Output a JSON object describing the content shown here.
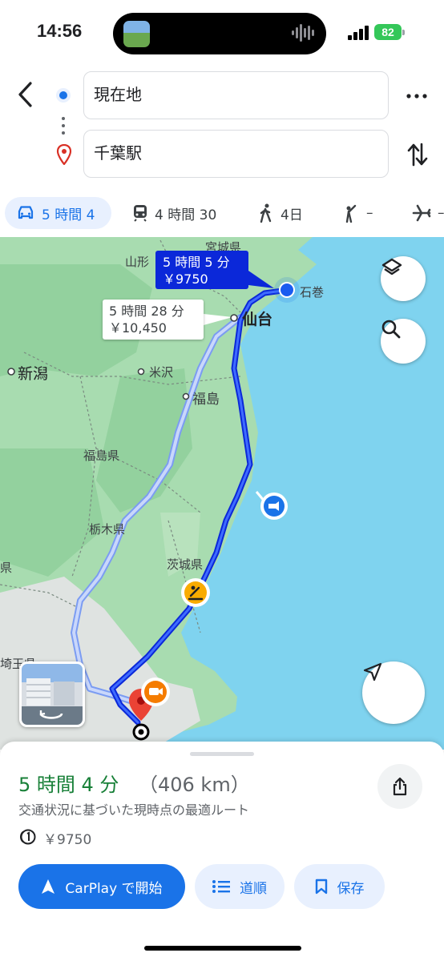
{
  "status_bar": {
    "time": "14:56",
    "battery": "82"
  },
  "route_inputs": {
    "origin": "現在地",
    "destination": "千葉駅"
  },
  "modes": [
    {
      "icon": "car-icon",
      "label": "5 時間 4"
    },
    {
      "icon": "train-icon",
      "label": "4 時間 30"
    },
    {
      "icon": "walk-icon",
      "label": "4日"
    },
    {
      "icon": "ride-icon",
      "label": "–"
    },
    {
      "icon": "flight-icon",
      "label": "–"
    }
  ],
  "map": {
    "route_fast": {
      "time": "5 時間 5 分",
      "cost": "￥9750"
    },
    "route_alt": {
      "time": "5 時間 28 分",
      "cost": "￥10,450"
    },
    "places": {
      "sendai": "仙台",
      "niigata": "新潟",
      "yonezawa": "米沢",
      "fukushima": "福島",
      "ishinomaki": "石巻",
      "yamagata": "山形",
      "miyagi": "宮城県",
      "fukushima_pref": "福島県",
      "tochigi": "栃木県",
      "ibaraki": "茨城県",
      "saitama": "埼玉県",
      "gunma": "県"
    }
  },
  "summary": {
    "duration": "5 時間 4 分",
    "distance": "（406 km）",
    "note": "交通状況に基づいた現時点の最適ルート",
    "toll": "￥9750"
  },
  "actions": {
    "start": "CarPlay で開始",
    "steps": "道順",
    "save": "保存"
  },
  "colors": {
    "accent": "#1a73e8",
    "route": "#0b28d9",
    "duration": "#188038",
    "water": "#7fd3ef",
    "land": "#a8dcb0"
  }
}
